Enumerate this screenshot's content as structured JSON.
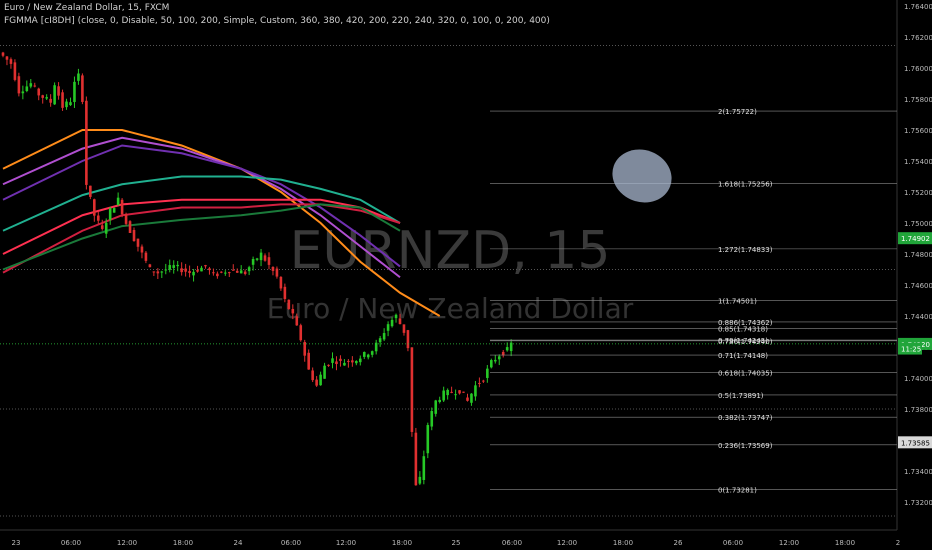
{
  "header": {
    "symbol_line": "Euro / New Zealand Dollar, 15, FXCM",
    "indicator_line": "FGMMA [cI8DH] (close, 0, Disable, 50, 100, 200, Simple, Custom, 360, 380, 420, 200, 220, 240, 320, 0, 100, 0, 200, 400)"
  },
  "watermark": {
    "ticker": "EURNZD, 15",
    "name": "Euro / New Zealand Dollar"
  },
  "colors": {
    "background": "#000000",
    "candle_up": "#26c926",
    "candle_down": "#e03030",
    "fib_line": "#8a8a8a",
    "current_price": "#2ecc40",
    "ellipse": "#aab8d0"
  },
  "chart_data": {
    "type": "candlestick",
    "ylim": [
      1.731,
      1.764
    ],
    "y_ticks": [
      "1.76400",
      "1.76200",
      "1.76000",
      "1.75800",
      "1.75600",
      "1.75400",
      "1.75200",
      "1.75000",
      "1.74800",
      "1.74600",
      "1.74400",
      "1.74200",
      "1.74000",
      "1.73800",
      "1.73600",
      "1.73400",
      "1.73200"
    ],
    "x_ticks": [
      "23",
      "06:00",
      "12:00",
      "18:00",
      "24",
      "06:00",
      "12:00",
      "18:00",
      "25",
      "06:00",
      "12:00",
      "18:00",
      "26",
      "06:00",
      "12:00",
      "18:00",
      "2"
    ],
    "price_badges": [
      {
        "label": "1.74902",
        "value": 1.74902,
        "style": "green"
      },
      {
        "label": "1.74220",
        "value": 1.7422,
        "style": "green"
      },
      {
        "label": "11:25",
        "value": 1.7419,
        "style": "green-small"
      },
      {
        "label": "1.73585",
        "value": 1.73585,
        "style": "gray"
      }
    ],
    "fibonacci": [
      {
        "label": "2(1.75722)",
        "value": 1.75722
      },
      {
        "label": "1.618(1.75256)",
        "value": 1.75256
      },
      {
        "label": "1.272(1.74833)",
        "value": 1.74833
      },
      {
        "label": "1(1.74501)",
        "value": 1.74501
      },
      {
        "label": "0.886(1.74362)",
        "value": 1.74362
      },
      {
        "label": "0.85(1.74318)",
        "value": 1.74318
      },
      {
        "label": "0.79(1.74245)",
        "value": 1.74245
      },
      {
        "label": "0.786(1.74240)",
        "value": 1.7424
      },
      {
        "label": "0.71(1.74148)",
        "value": 1.74148
      },
      {
        "label": "0.618(1.74035)",
        "value": 1.74035
      },
      {
        "label": "0.5(1.73891)",
        "value": 1.73891
      },
      {
        "label": "0.382(1.73747)",
        "value": 1.73747
      },
      {
        "label": "0.236(1.73569)",
        "value": 1.73569
      },
      {
        "label": "0(1.73281)",
        "value": 1.73281
      }
    ],
    "current_price": 1.7422,
    "horizontal_lines": [
      1.76145,
      1.747,
      1.738,
      1.7311
    ],
    "price_path": [
      [
        0,
        1.761
      ],
      [
        3,
        1.7603
      ],
      [
        5,
        1.7585
      ],
      [
        8,
        1.759
      ],
      [
        10,
        1.7583
      ],
      [
        13,
        1.7578
      ],
      [
        14,
        1.759
      ],
      [
        16,
        1.7575
      ],
      [
        18,
        1.7579
      ],
      [
        19,
        1.759
      ],
      [
        20,
        1.7595
      ],
      [
        21,
        1.758
      ],
      [
        22,
        1.7525
      ],
      [
        24,
        1.7505
      ],
      [
        26,
        1.7495
      ],
      [
        28,
        1.7508
      ],
      [
        30,
        1.7515
      ],
      [
        32,
        1.75
      ],
      [
        34,
        1.749
      ],
      [
        36,
        1.748
      ],
      [
        38,
        1.747
      ],
      [
        40,
        1.7468
      ],
      [
        44,
        1.7472
      ],
      [
        48,
        1.7468
      ],
      [
        52,
        1.7472
      ],
      [
        54,
        1.7466
      ],
      [
        58,
        1.747
      ],
      [
        62,
        1.7468
      ],
      [
        64,
        1.7475
      ],
      [
        66,
        1.748
      ],
      [
        70,
        1.7465
      ],
      [
        72,
        1.745
      ],
      [
        74,
        1.744
      ],
      [
        76,
        1.7425
      ],
      [
        78,
        1.7405
      ],
      [
        80,
        1.7395
      ],
      [
        82,
        1.7408
      ],
      [
        84,
        1.7412
      ],
      [
        86,
        1.741
      ],
      [
        90,
        1.7412
      ],
      [
        94,
        1.7418
      ],
      [
        96,
        1.7425
      ],
      [
        98,
        1.7435
      ],
      [
        100,
        1.744
      ],
      [
        102,
        1.743
      ],
      [
        103,
        1.742
      ],
      [
        104,
        1.7365
      ],
      [
        105,
        1.733
      ],
      [
        106,
        1.7335
      ],
      [
        107,
        1.735
      ],
      [
        108,
        1.737
      ],
      [
        110,
        1.7385
      ],
      [
        112,
        1.739
      ],
      [
        116,
        1.7392
      ],
      [
        118,
        1.7385
      ],
      [
        120,
        1.7395
      ],
      [
        122,
        1.74
      ],
      [
        124,
        1.741
      ],
      [
        126,
        1.7415
      ],
      [
        128,
        1.7418
      ],
      [
        129,
        1.7422
      ]
    ],
    "moving_averages": [
      {
        "color": "#ff8c1a",
        "points": [
          [
            0,
            1.7535
          ],
          [
            20,
            1.756
          ],
          [
            30,
            1.756
          ],
          [
            45,
            1.755
          ],
          [
            60,
            1.7535
          ],
          [
            70,
            1.752
          ],
          [
            80,
            1.75
          ],
          [
            90,
            1.7475
          ],
          [
            100,
            1.7455
          ],
          [
            110,
            1.744
          ]
        ]
      },
      {
        "color": "#b04fd0",
        "points": [
          [
            0,
            1.7525
          ],
          [
            20,
            1.7548
          ],
          [
            30,
            1.7555
          ],
          [
            45,
            1.7548
          ],
          [
            60,
            1.7535
          ],
          [
            70,
            1.7522
          ],
          [
            80,
            1.7505
          ],
          [
            90,
            1.7485
          ],
          [
            100,
            1.7465
          ]
        ]
      },
      {
        "color": "#7030b0",
        "points": [
          [
            0,
            1.7515
          ],
          [
            20,
            1.754
          ],
          [
            30,
            1.755
          ],
          [
            45,
            1.7545
          ],
          [
            60,
            1.7535
          ],
          [
            70,
            1.7525
          ],
          [
            80,
            1.751
          ],
          [
            90,
            1.7492
          ],
          [
            100,
            1.7472
          ]
        ]
      },
      {
        "color": "#20b090",
        "points": [
          [
            0,
            1.7495
          ],
          [
            20,
            1.7518
          ],
          [
            30,
            1.7525
          ],
          [
            45,
            1.753
          ],
          [
            60,
            1.753
          ],
          [
            70,
            1.7528
          ],
          [
            80,
            1.7522
          ],
          [
            90,
            1.7515
          ],
          [
            100,
            1.75
          ]
        ]
      },
      {
        "color": "#ff3050",
        "points": [
          [
            0,
            1.748
          ],
          [
            20,
            1.7505
          ],
          [
            30,
            1.7512
          ],
          [
            45,
            1.7515
          ],
          [
            60,
            1.7515
          ],
          [
            70,
            1.7515
          ],
          [
            80,
            1.7515
          ],
          [
            90,
            1.751
          ],
          [
            100,
            1.75
          ]
        ]
      },
      {
        "color": "#d02040",
        "points": [
          [
            0,
            1.7468
          ],
          [
            20,
            1.7495
          ],
          [
            30,
            1.7505
          ],
          [
            45,
            1.751
          ],
          [
            60,
            1.751
          ],
          [
            70,
            1.7512
          ],
          [
            80,
            1.7512
          ],
          [
            90,
            1.7508
          ],
          [
            100,
            1.75
          ]
        ]
      },
      {
        "color": "#1a7a3a",
        "points": [
          [
            0,
            1.747
          ],
          [
            20,
            1.749
          ],
          [
            30,
            1.7498
          ],
          [
            45,
            1.7502
          ],
          [
            60,
            1.7505
          ],
          [
            70,
            1.7508
          ],
          [
            80,
            1.7512
          ],
          [
            90,
            1.751
          ],
          [
            100,
            1.7495
          ]
        ]
      }
    ]
  }
}
